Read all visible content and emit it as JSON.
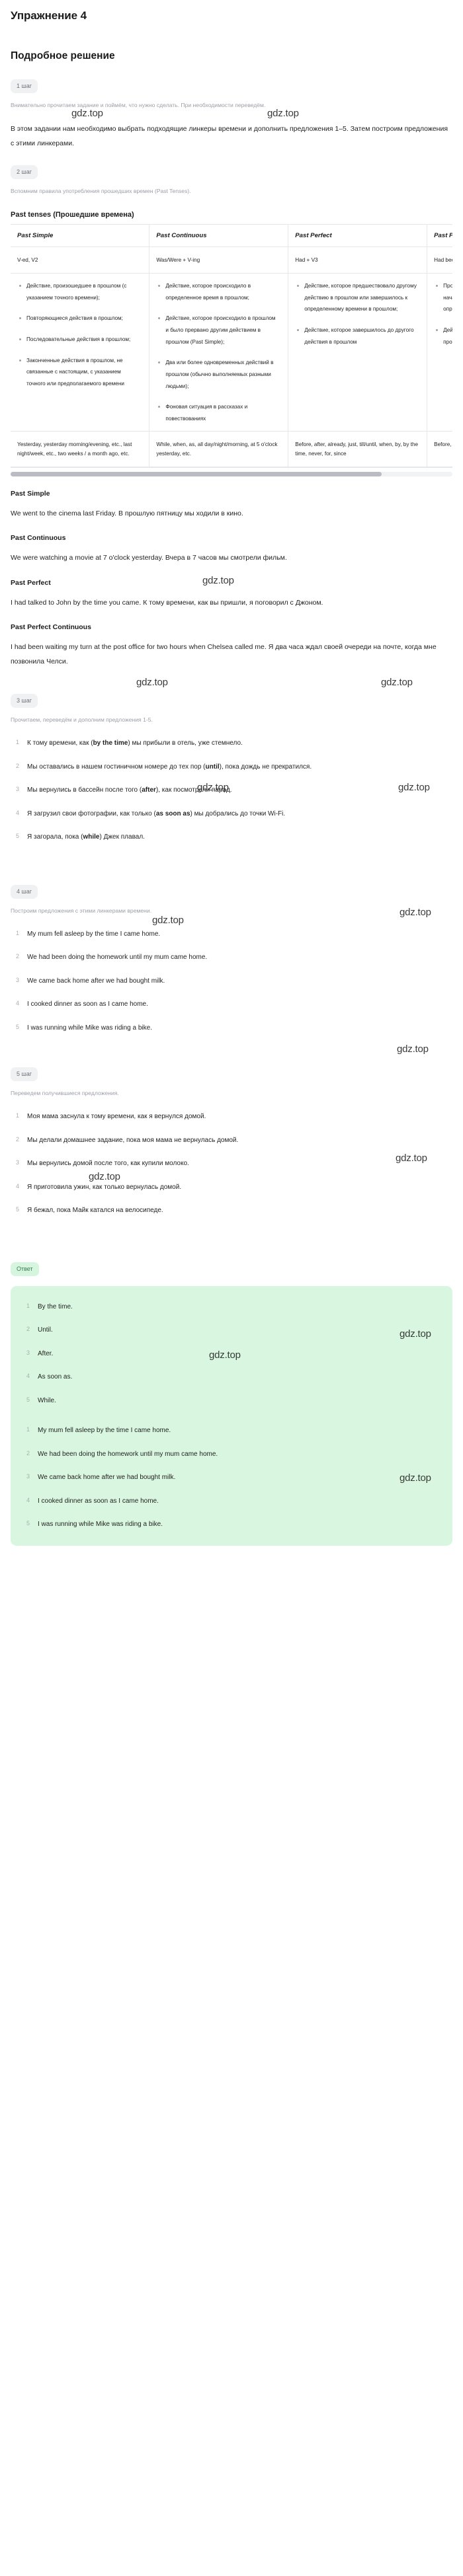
{
  "header": {
    "exercise_title": "Упражнение 4",
    "solution_title": "Подробное решение"
  },
  "steps": {
    "step1_label": "1 шаг",
    "step1_intro": "Внимательно прочитаем задание и поймём, что нужно сделать. При необходимости переведём.",
    "step1_body": "В этом задании нам необходимо выбрать подходящие линкеры времени и дополнить предложения 1–5. Затем построим предложения с этими линкерами.",
    "step2_label": "2 шаг",
    "step2_intro": "Вспомним правила употребления прошедших времен (Past Tenses).",
    "step3_label": "3 шаг",
    "step3_intro": "Прочитаем, переведём и дополним предложения 1-5.",
    "step4_label": "4 шаг",
    "step4_intro": "Построим предложения с этими линкерами времени.",
    "step5_label": "5 шаг",
    "step5_intro": "Переведем получившиеся предложения.",
    "answer_label": "Ответ"
  },
  "table": {
    "caption": "Past tenses (Прошедшие времена)",
    "headers": [
      "Past Simple",
      "Past Continuous",
      "Past Perfect",
      "Past Perfect Continuous"
    ],
    "formulas": [
      "V-ed, V2",
      "Was/Were + V-ing",
      "Had + V3",
      "Had been + V-ing"
    ],
    "usage": [
      [
        "Действие, произошедшее в прошлом (с указанием точного времени);",
        "Повторяющиеся действия в прошлом;",
        "Последовательные действия в прошлом;",
        "Законченные действия в прошлом, не связанные с настоящим, с указанием точного или предполагаемого времени"
      ],
      [
        "Действие, которое происходило в определенное время в прошлом;",
        "Действие, которое происходило в прошлом и было прервано другим действием в прошлом (Past Simple);",
        "Два или более одновременных действий в прошлом (обычно выполняемых разными людьми);",
        "Фоновая ситуация в рассказах и повествованиях"
      ],
      [
        "Действие, которое предшествовало другому действию в прошлом или завершилось к определенному времени в прошлом;",
        "Действие, которое завершилось до другого действия в прошлом"
      ],
      [
        "Продолжительное действие, которое началось в прошлом и продолжалось до определенного момента в прошлом;",
        "Действие, результат которого виден в прошлом"
      ]
    ],
    "markers": [
      "Yesterday, yesterday morning/evening, etc., last night/week, etc., two weeks / a month ago, etc.",
      "While, when, as, all day/night/morning, at 5 o'clock yesterday, etc.",
      "Before, after, already, just, till/until, when, by, by the time, never, for, since",
      "Before, since, how long, till/until"
    ]
  },
  "tense_examples": [
    {
      "name": "Past Simple",
      "sentence": "We went to the cinema last Friday. В прошлую пятницу мы ходили в кино."
    },
    {
      "name": "Past Continuous",
      "sentence": "We were watching a movie at 7 o'clock yesterday. Вчера в 7 часов мы смотрели фильм."
    },
    {
      "name": "Past Perfect",
      "sentence": "I had talked to John by the time you came. К тому времени, как вы пришли, я поговорил с Джоном."
    },
    {
      "name": "Past Perfect Continuous",
      "sentence": "I had been waiting my turn at the post office for two hours when Chelsea called me. Я два часа ждал своей очереди на почте, когда мне позвонила Челси."
    }
  ],
  "step3_items": [
    {
      "pre": "К тому времени, как (",
      "bold": "by the time",
      "post": ") мы прибыли в отель, уже стемнело."
    },
    {
      "pre": "Мы оставались в нашем гостиничном номере до тех пор (",
      "bold": "until",
      "post": "), пока дождь не прекратился."
    },
    {
      "pre": "Мы вернулись в бассейн после того (",
      "bold": "after",
      "post": "), как посмотрели парад."
    },
    {
      "pre": "Я загрузил свои фотографии, как только (",
      "bold": "as soon as",
      "post": ") мы добрались до точки Wi-Fi."
    },
    {
      "pre": "Я загорала, пока (",
      "bold": "while",
      "post": ") Джек плавал."
    }
  ],
  "step4_items": [
    "My mum fell asleep by the time I came home.",
    "We had been doing the homework until my mum came home.",
    "We came back home after we had bought milk.",
    "I cooked dinner as soon as I came home.",
    "I was running while Mike was riding a bike."
  ],
  "step5_items": [
    "Моя мама заснула к тому времени, как я вернулся домой.",
    "Мы делали домашнее задание, пока моя мама не вернулась домой.",
    "Мы вернулись домой после того, как купили молоко.",
    "Я приготовила ужин, как только вернулась домой.",
    "Я бежал, пока Майк катался на велосипеде."
  ],
  "answer": {
    "linkers": [
      "By the time.",
      "Until.",
      "After.",
      "As soon as.",
      "While."
    ],
    "sentences": [
      "My mum fell asleep by the time I came home.",
      "We had been doing the homework until my mum came home.",
      "We came back home after we had bought milk.",
      "I cooked dinner as soon as I came home.",
      "I was running while Mike was riding a bike."
    ]
  },
  "watermark": {
    "text": "gdz.top"
  },
  "colors": {
    "answer_bg": "#d9f7e0",
    "chip_bg": "#f0f1f3",
    "accent_green": "#3a7a4e"
  }
}
